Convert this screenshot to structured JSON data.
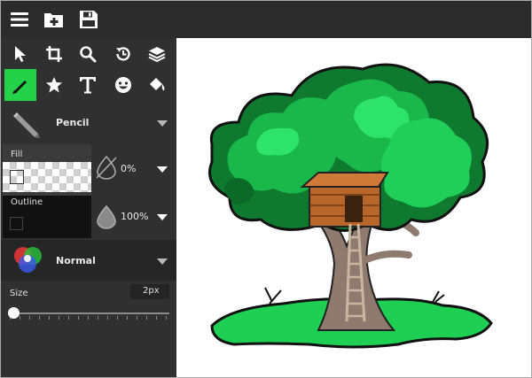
{
  "topbar": {
    "icons": [
      "menu-icon",
      "add-folder-icon",
      "save-icon"
    ]
  },
  "tools": [
    {
      "name": "select-icon"
    },
    {
      "name": "crop-icon"
    },
    {
      "name": "zoom-icon"
    },
    {
      "name": "history-icon"
    },
    {
      "name": "layers-icon"
    },
    {
      "name": "pencil-icon",
      "active": true
    },
    {
      "name": "star-icon"
    },
    {
      "name": "text-icon"
    },
    {
      "name": "emoji-icon"
    },
    {
      "name": "fill-bucket-icon"
    }
  ],
  "brush": {
    "name": "Pencil"
  },
  "fill": {
    "label": "Fill",
    "opacity": "0%"
  },
  "outline": {
    "label": "Outline",
    "opacity": "100%"
  },
  "blend": {
    "mode": "Normal"
  },
  "size": {
    "label": "Size",
    "value": "2px"
  },
  "colors": {
    "accent": "#24d24a",
    "panel": "#303030",
    "topbar": "#2b2b2b"
  }
}
